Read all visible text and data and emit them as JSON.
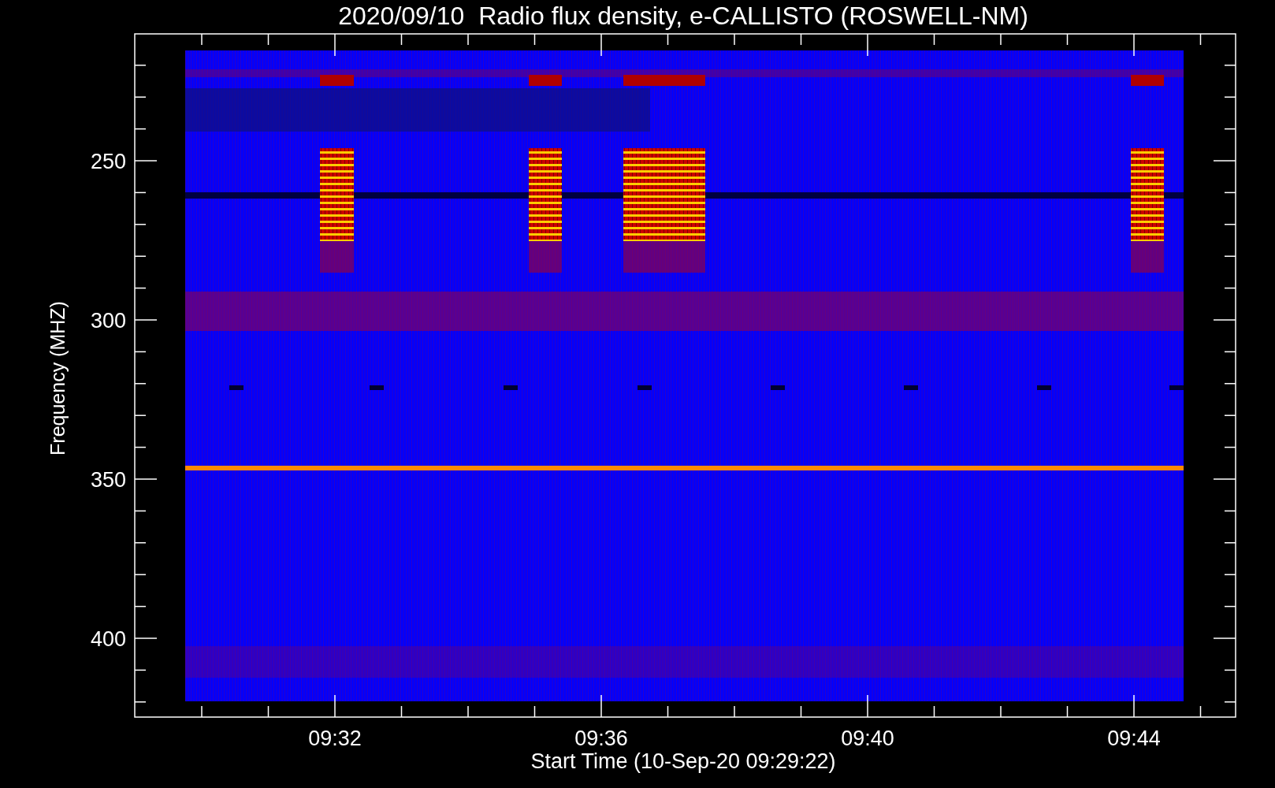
{
  "title": "2020/09/10  Radio flux density, e-CALLISTO (ROSWELL-NM)",
  "y_axis": {
    "label": "Frequency (MHZ)",
    "ticks": [
      "250",
      "300",
      "350",
      "400"
    ]
  },
  "x_axis": {
    "label": "Start Time (10-Sep-20 09:29:22)",
    "ticks": [
      "09:32",
      "09:36",
      "09:40",
      "09:44"
    ]
  }
}
